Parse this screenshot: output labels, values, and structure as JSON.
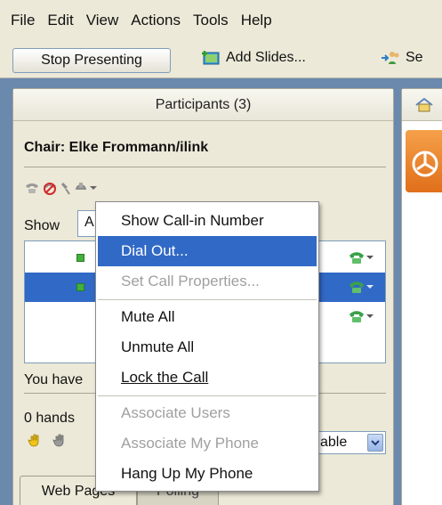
{
  "menubar": {
    "items": [
      "File",
      "Edit",
      "View",
      "Actions",
      "Tools",
      "Help"
    ]
  },
  "toolbar": {
    "stop_presenting": "Stop Presenting",
    "add_slides": "Add Slides...",
    "set_partial": "Se"
  },
  "participants_panel": {
    "title": "Participants (3)",
    "chair": "Chair: Elke Frommann/ilink",
    "show_label": "Show",
    "show_value": "A",
    "you_have": "You have",
    "hands": "0 hands",
    "availability_value": "able"
  },
  "context_menu": {
    "items": [
      {
        "label": "Show Call-in Number",
        "state": "enabled"
      },
      {
        "label": "Dial Out...",
        "state": "highlighted"
      },
      {
        "label": "Set Call Properties...",
        "state": "disabled"
      },
      {
        "label": "Mute All",
        "state": "enabled"
      },
      {
        "label": "Unmute All",
        "state": "enabled"
      },
      {
        "label": "Lock the Call",
        "state": "enabled"
      },
      {
        "label": "Associate Users",
        "state": "disabled"
      },
      {
        "label": "Associate My Phone",
        "state": "disabled"
      },
      {
        "label": "Hang Up My Phone",
        "state": "enabled"
      }
    ]
  },
  "tabs": {
    "web_pages": "Web Pages",
    "polling": "Polling"
  },
  "colors": {
    "highlight": "#3169c6",
    "frame": "#6b88ad",
    "panel": "#ece9d8"
  }
}
